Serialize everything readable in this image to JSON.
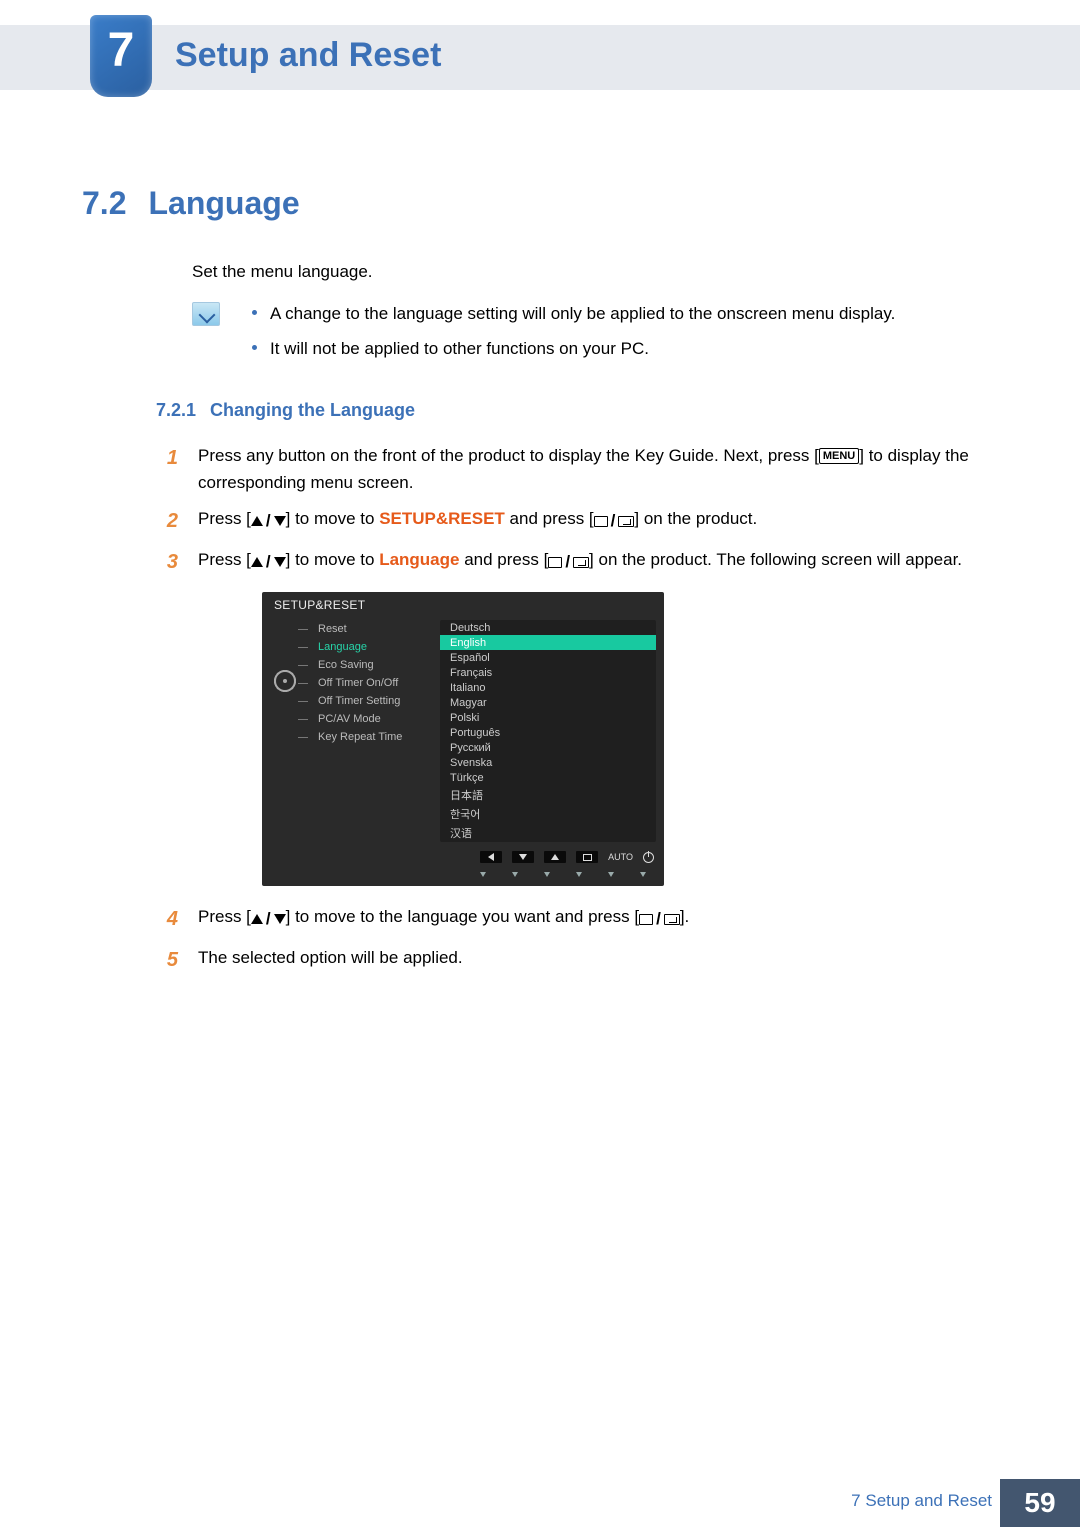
{
  "chapter": {
    "number": "7",
    "title": "Setup and Reset"
  },
  "section": {
    "number": "7.2",
    "title": "Language",
    "intro": "Set the menu language.",
    "notes": [
      "A change to the language setting will only be applied to the onscreen menu display.",
      "It will not be applied to other functions on your PC."
    ]
  },
  "subsection": {
    "number": "7.2.1",
    "title": "Changing the Language"
  },
  "steps": {
    "s1_a": "Press any button on the front of the product to display the Key Guide. Next, press [",
    "s1_menu": "MENU",
    "s1_b": "] to display the corresponding menu screen.",
    "s2_a": "Press [",
    "s2_b": "] to move to ",
    "s2_target": "SETUP&RESET",
    "s2_c": " and press [",
    "s2_d": "] on the product.",
    "s3_a": "Press [",
    "s3_b": "] to move to ",
    "s3_target": "Language",
    "s3_c": " and press [",
    "s3_d": "] on the product. The following screen will appear.",
    "s4_a": "Press [",
    "s4_b": "] to move to the language you want and press [",
    "s4_c": "].",
    "s5": "The selected option will be applied.",
    "n1": "1",
    "n2": "2",
    "n3": "3",
    "n4": "4",
    "n5": "5"
  },
  "osd": {
    "title": "SETUP&RESET",
    "left_menu": [
      "Reset",
      "Language",
      "Eco Saving",
      "Off Timer On/Off",
      "Off Timer Setting",
      "PC/AV Mode",
      "Key Repeat Time"
    ],
    "active_index": 1,
    "languages": [
      "Deutsch",
      "English",
      "Español",
      "Français",
      "Italiano",
      "Magyar",
      "Polski",
      "Português",
      "Русский",
      "Svenska",
      "Türkçe",
      "日本語",
      "한국어",
      "汉语"
    ],
    "selected_lang_index": 1,
    "footer_auto": "AUTO"
  },
  "footer": {
    "breadcrumb": "7 Setup and Reset",
    "page": "59"
  }
}
